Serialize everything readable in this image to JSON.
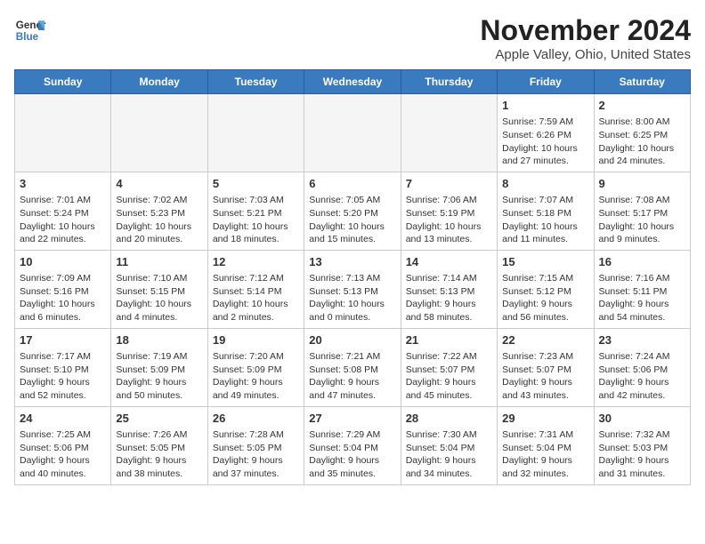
{
  "header": {
    "logo_line1": "General",
    "logo_line2": "Blue",
    "month_title": "November 2024",
    "location": "Apple Valley, Ohio, United States"
  },
  "days_of_week": [
    "Sunday",
    "Monday",
    "Tuesday",
    "Wednesday",
    "Thursday",
    "Friday",
    "Saturday"
  ],
  "weeks": [
    [
      {
        "day": "",
        "info": ""
      },
      {
        "day": "",
        "info": ""
      },
      {
        "day": "",
        "info": ""
      },
      {
        "day": "",
        "info": ""
      },
      {
        "day": "",
        "info": ""
      },
      {
        "day": "1",
        "info": "Sunrise: 7:59 AM\nSunset: 6:26 PM\nDaylight: 10 hours and 27 minutes."
      },
      {
        "day": "2",
        "info": "Sunrise: 8:00 AM\nSunset: 6:25 PM\nDaylight: 10 hours and 24 minutes."
      }
    ],
    [
      {
        "day": "3",
        "info": "Sunrise: 7:01 AM\nSunset: 5:24 PM\nDaylight: 10 hours and 22 minutes."
      },
      {
        "day": "4",
        "info": "Sunrise: 7:02 AM\nSunset: 5:23 PM\nDaylight: 10 hours and 20 minutes."
      },
      {
        "day": "5",
        "info": "Sunrise: 7:03 AM\nSunset: 5:21 PM\nDaylight: 10 hours and 18 minutes."
      },
      {
        "day": "6",
        "info": "Sunrise: 7:05 AM\nSunset: 5:20 PM\nDaylight: 10 hours and 15 minutes."
      },
      {
        "day": "7",
        "info": "Sunrise: 7:06 AM\nSunset: 5:19 PM\nDaylight: 10 hours and 13 minutes."
      },
      {
        "day": "8",
        "info": "Sunrise: 7:07 AM\nSunset: 5:18 PM\nDaylight: 10 hours and 11 minutes."
      },
      {
        "day": "9",
        "info": "Sunrise: 7:08 AM\nSunset: 5:17 PM\nDaylight: 10 hours and 9 minutes."
      }
    ],
    [
      {
        "day": "10",
        "info": "Sunrise: 7:09 AM\nSunset: 5:16 PM\nDaylight: 10 hours and 6 minutes."
      },
      {
        "day": "11",
        "info": "Sunrise: 7:10 AM\nSunset: 5:15 PM\nDaylight: 10 hours and 4 minutes."
      },
      {
        "day": "12",
        "info": "Sunrise: 7:12 AM\nSunset: 5:14 PM\nDaylight: 10 hours and 2 minutes."
      },
      {
        "day": "13",
        "info": "Sunrise: 7:13 AM\nSunset: 5:13 PM\nDaylight: 10 hours and 0 minutes."
      },
      {
        "day": "14",
        "info": "Sunrise: 7:14 AM\nSunset: 5:13 PM\nDaylight: 9 hours and 58 minutes."
      },
      {
        "day": "15",
        "info": "Sunrise: 7:15 AM\nSunset: 5:12 PM\nDaylight: 9 hours and 56 minutes."
      },
      {
        "day": "16",
        "info": "Sunrise: 7:16 AM\nSunset: 5:11 PM\nDaylight: 9 hours and 54 minutes."
      }
    ],
    [
      {
        "day": "17",
        "info": "Sunrise: 7:17 AM\nSunset: 5:10 PM\nDaylight: 9 hours and 52 minutes."
      },
      {
        "day": "18",
        "info": "Sunrise: 7:19 AM\nSunset: 5:09 PM\nDaylight: 9 hours and 50 minutes."
      },
      {
        "day": "19",
        "info": "Sunrise: 7:20 AM\nSunset: 5:09 PM\nDaylight: 9 hours and 49 minutes."
      },
      {
        "day": "20",
        "info": "Sunrise: 7:21 AM\nSunset: 5:08 PM\nDaylight: 9 hours and 47 minutes."
      },
      {
        "day": "21",
        "info": "Sunrise: 7:22 AM\nSunset: 5:07 PM\nDaylight: 9 hours and 45 minutes."
      },
      {
        "day": "22",
        "info": "Sunrise: 7:23 AM\nSunset: 5:07 PM\nDaylight: 9 hours and 43 minutes."
      },
      {
        "day": "23",
        "info": "Sunrise: 7:24 AM\nSunset: 5:06 PM\nDaylight: 9 hours and 42 minutes."
      }
    ],
    [
      {
        "day": "24",
        "info": "Sunrise: 7:25 AM\nSunset: 5:06 PM\nDaylight: 9 hours and 40 minutes."
      },
      {
        "day": "25",
        "info": "Sunrise: 7:26 AM\nSunset: 5:05 PM\nDaylight: 9 hours and 38 minutes."
      },
      {
        "day": "26",
        "info": "Sunrise: 7:28 AM\nSunset: 5:05 PM\nDaylight: 9 hours and 37 minutes."
      },
      {
        "day": "27",
        "info": "Sunrise: 7:29 AM\nSunset: 5:04 PM\nDaylight: 9 hours and 35 minutes."
      },
      {
        "day": "28",
        "info": "Sunrise: 7:30 AM\nSunset: 5:04 PM\nDaylight: 9 hours and 34 minutes."
      },
      {
        "day": "29",
        "info": "Sunrise: 7:31 AM\nSunset: 5:04 PM\nDaylight: 9 hours and 32 minutes."
      },
      {
        "day": "30",
        "info": "Sunrise: 7:32 AM\nSunset: 5:03 PM\nDaylight: 9 hours and 31 minutes."
      }
    ]
  ]
}
